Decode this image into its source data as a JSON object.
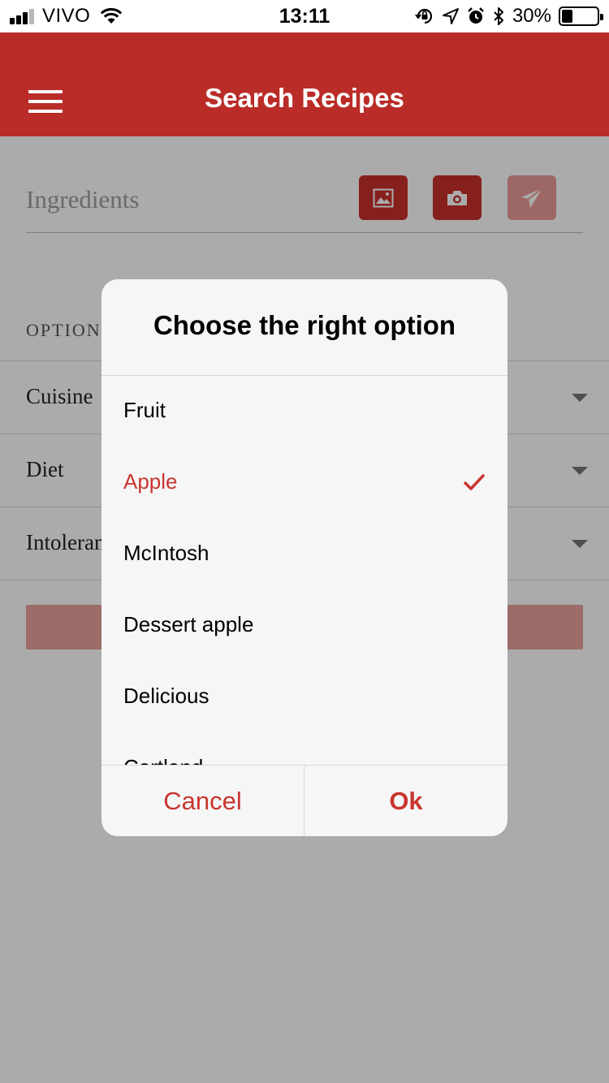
{
  "status_bar": {
    "carrier": "VIVO",
    "time": "13:11",
    "battery_percent": "30%",
    "battery_level": 0.3,
    "signal_bars": 3,
    "icons": [
      "signal-icon",
      "wifi-icon",
      "orientation-lock-icon",
      "location-icon",
      "alarm-icon",
      "bluetooth-icon",
      "battery-icon"
    ]
  },
  "navbar": {
    "title": "Search Recipes",
    "menu_icon": "hamburger-menu-icon"
  },
  "search": {
    "placeholder": "Ingredients",
    "buttons": [
      {
        "name": "gallery-button",
        "icon": "image-icon",
        "enabled": true
      },
      {
        "name": "camera-button",
        "icon": "camera-icon",
        "enabled": true
      },
      {
        "name": "send-button",
        "icon": "paper-plane-icon",
        "enabled": false
      }
    ]
  },
  "options": {
    "label": "OPTIONS",
    "rows": [
      {
        "label": "Cuisine"
      },
      {
        "label": "Diet"
      },
      {
        "label": "Intolerances"
      }
    ]
  },
  "dialog": {
    "title": "Choose the right option",
    "items": [
      "Fruit",
      "Apple",
      "McIntosh",
      "Dessert apple",
      "Delicious",
      "Cortland"
    ],
    "selected_index": 1,
    "cancel_label": "Cancel",
    "ok_label": "Ok"
  },
  "colors": {
    "brand_red": "#ba2c28",
    "button_red": "#c8302a",
    "accent_text_red": "#c8362f",
    "disabled_red": "#eb9a97"
  }
}
